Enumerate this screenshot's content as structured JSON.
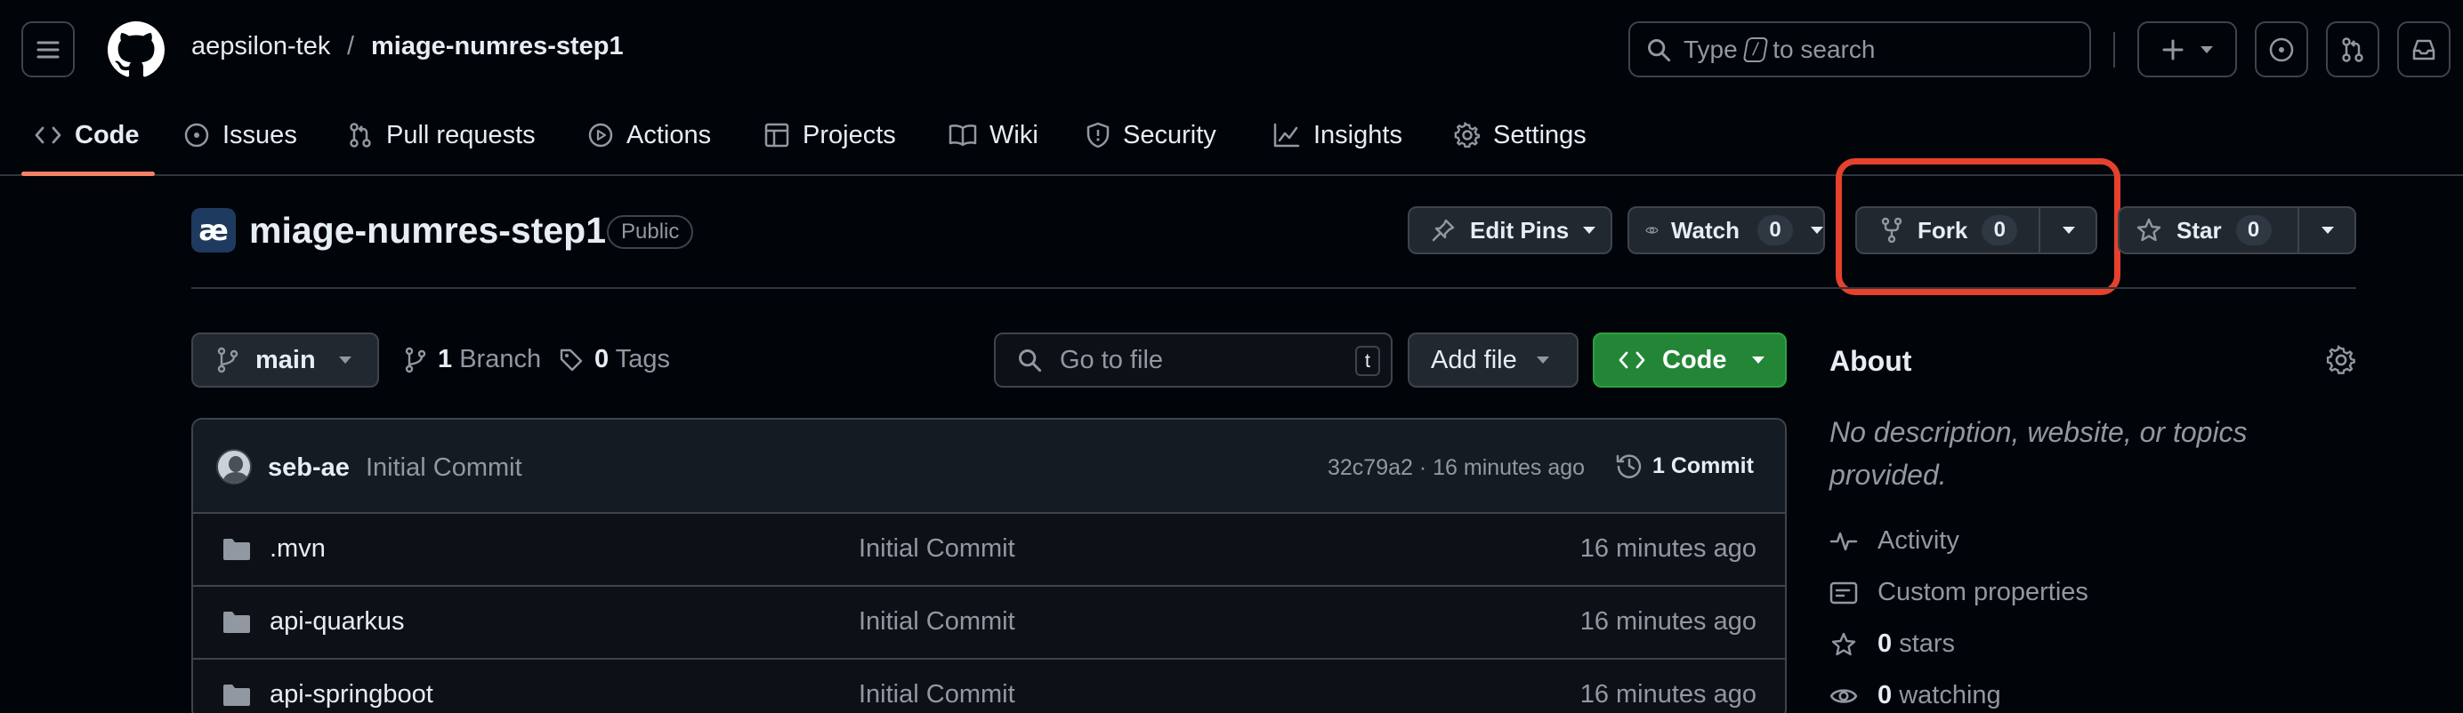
{
  "header": {
    "owner": "aepsilon-tek",
    "separator": "/",
    "repo": "miage-numres-step1",
    "search_prefix": "Type",
    "search_key": "/",
    "search_suffix": "to search"
  },
  "nav_tabs": [
    {
      "label": "Code",
      "icon": "code-icon",
      "active": true
    },
    {
      "label": "Issues",
      "icon": "issue-icon"
    },
    {
      "label": "Pull requests",
      "icon": "pull-request-icon"
    },
    {
      "label": "Actions",
      "icon": "play-icon"
    },
    {
      "label": "Projects",
      "icon": "table-icon"
    },
    {
      "label": "Wiki",
      "icon": "book-icon"
    },
    {
      "label": "Security",
      "icon": "shield-icon"
    },
    {
      "label": "Insights",
      "icon": "graph-icon"
    },
    {
      "label": "Settings",
      "icon": "gear-icon"
    }
  ],
  "repo_header": {
    "avatar_text": "æ",
    "title": "miage-numres-step1",
    "visibility": "Public",
    "edit_pins": "Edit Pins",
    "watch": "Watch",
    "watch_count": "0",
    "fork": "Fork",
    "fork_count": "0",
    "star": "Star",
    "star_count": "0",
    "highlight_color": "#e5412d"
  },
  "toolbar": {
    "branch": "main",
    "branches_count": "1",
    "branches_label": "Branch",
    "tags_count": "0",
    "tags_label": "Tags",
    "go_to_file": "Go to file",
    "go_to_file_key": "t",
    "add_file": "Add file",
    "code": "Code"
  },
  "latest_commit": {
    "author": "seb-ae",
    "message": "Initial Commit",
    "hash_time": "32c79a2 · 16 minutes ago",
    "commits_count": "1",
    "commits_label": "Commit"
  },
  "files": [
    {
      "name": ".mvn",
      "message": "Initial Commit",
      "time": "16 minutes ago"
    },
    {
      "name": "api-quarkus",
      "message": "Initial Commit",
      "time": "16 minutes ago"
    },
    {
      "name": "api-springboot",
      "message": "Initial Commit",
      "time": "16 minutes ago"
    }
  ],
  "about": {
    "title": "About",
    "description": "No description, website, or topics provided.",
    "activity": "Activity",
    "custom_properties": "Custom properties",
    "stars_count": "0",
    "stars_label": "stars",
    "watching_count": "0",
    "watching_label": "watching"
  },
  "colors": {
    "accent_underline": "#f78166",
    "code_button": "#238636"
  }
}
